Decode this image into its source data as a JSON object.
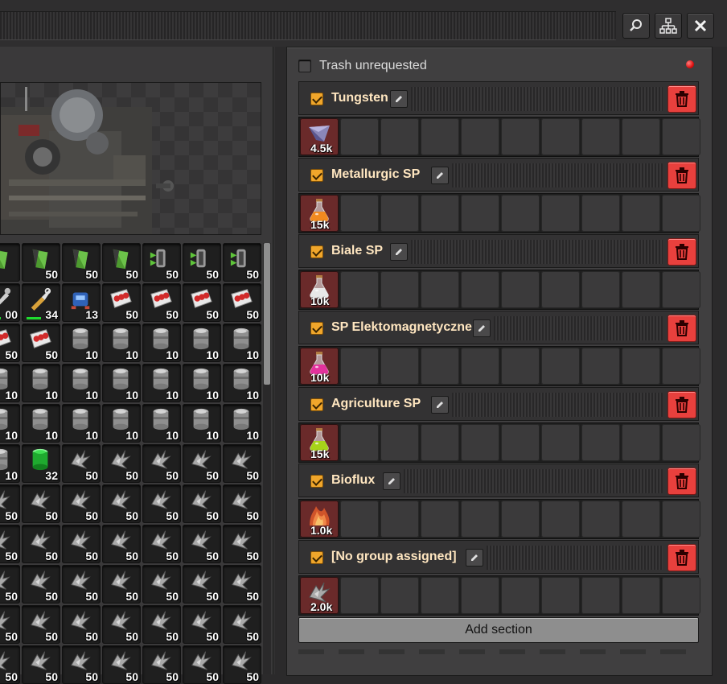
{
  "window": {
    "buttons": [
      {
        "name": "search-button",
        "icon": "search-icon"
      },
      {
        "name": "tree-button",
        "icon": "network-tree-icon"
      },
      {
        "name": "close-button",
        "icon": "close-icon"
      }
    ]
  },
  "inventory": {
    "rows": [
      [
        {
          "icon": "green-item",
          "qty": ""
        },
        {
          "icon": "green-item",
          "qty": "50"
        },
        {
          "icon": "green-item",
          "qty": "50"
        },
        {
          "icon": "green-item",
          "qty": "50"
        },
        {
          "icon": "chain-item",
          "qty": "50"
        },
        {
          "icon": "chain-item",
          "qty": "50"
        },
        {
          "icon": "chain-item",
          "qty": "50"
        }
      ],
      [
        {
          "icon": "tool",
          "qty": "00"
        },
        {
          "icon": "wrench",
          "qty": "34"
        },
        {
          "icon": "blue-robot",
          "qty": "13"
        },
        {
          "icon": "red-card",
          "qty": "50"
        },
        {
          "icon": "red-card",
          "qty": "50"
        },
        {
          "icon": "red-card",
          "qty": "50"
        },
        {
          "icon": "red-card",
          "qty": "50"
        }
      ],
      [
        {
          "icon": "red-card",
          "qty": "50"
        },
        {
          "icon": "red-card",
          "qty": "50"
        },
        {
          "icon": "barrel",
          "qty": "10"
        },
        {
          "icon": "barrel",
          "qty": "10"
        },
        {
          "icon": "barrel",
          "qty": "10"
        },
        {
          "icon": "barrel",
          "qty": "10"
        },
        {
          "icon": "barrel",
          "qty": "10"
        }
      ],
      [
        {
          "icon": "barrel",
          "qty": "10"
        },
        {
          "icon": "barrel",
          "qty": "10"
        },
        {
          "icon": "barrel",
          "qty": "10"
        },
        {
          "icon": "barrel",
          "qty": "10"
        },
        {
          "icon": "barrel",
          "qty": "10"
        },
        {
          "icon": "barrel",
          "qty": "10"
        },
        {
          "icon": "barrel",
          "qty": "10"
        }
      ],
      [
        {
          "icon": "barrel",
          "qty": "10"
        },
        {
          "icon": "barrel",
          "qty": "10"
        },
        {
          "icon": "barrel",
          "qty": "10"
        },
        {
          "icon": "barrel",
          "qty": "10"
        },
        {
          "icon": "barrel",
          "qty": "10"
        },
        {
          "icon": "barrel",
          "qty": "10"
        },
        {
          "icon": "barrel",
          "qty": "10"
        }
      ],
      [
        {
          "icon": "barrel",
          "qty": "10"
        },
        {
          "icon": "green-barrel",
          "qty": "32"
        },
        {
          "icon": "scrap",
          "qty": "50"
        },
        {
          "icon": "scrap",
          "qty": "50"
        },
        {
          "icon": "scrap",
          "qty": "50"
        },
        {
          "icon": "scrap",
          "qty": "50"
        },
        {
          "icon": "scrap",
          "qty": "50"
        }
      ],
      [
        {
          "icon": "scrap",
          "qty": "50"
        },
        {
          "icon": "scrap",
          "qty": "50"
        },
        {
          "icon": "scrap",
          "qty": "50"
        },
        {
          "icon": "scrap",
          "qty": "50"
        },
        {
          "icon": "scrap",
          "qty": "50"
        },
        {
          "icon": "scrap",
          "qty": "50"
        },
        {
          "icon": "scrap",
          "qty": "50"
        }
      ],
      [
        {
          "icon": "scrap",
          "qty": "50"
        },
        {
          "icon": "scrap",
          "qty": "50"
        },
        {
          "icon": "scrap",
          "qty": "50"
        },
        {
          "icon": "scrap",
          "qty": "50"
        },
        {
          "icon": "scrap",
          "qty": "50"
        },
        {
          "icon": "scrap",
          "qty": "50"
        },
        {
          "icon": "scrap",
          "qty": "50"
        }
      ],
      [
        {
          "icon": "scrap",
          "qty": "50"
        },
        {
          "icon": "scrap",
          "qty": "50"
        },
        {
          "icon": "scrap",
          "qty": "50"
        },
        {
          "icon": "scrap",
          "qty": "50"
        },
        {
          "icon": "scrap",
          "qty": "50"
        },
        {
          "icon": "scrap",
          "qty": "50"
        },
        {
          "icon": "scrap",
          "qty": "50"
        }
      ],
      [
        {
          "icon": "scrap",
          "qty": "50"
        },
        {
          "icon": "scrap",
          "qty": "50"
        },
        {
          "icon": "scrap",
          "qty": "50"
        },
        {
          "icon": "scrap",
          "qty": "50"
        },
        {
          "icon": "scrap",
          "qty": "50"
        },
        {
          "icon": "scrap",
          "qty": "50"
        },
        {
          "icon": "scrap",
          "qty": "50"
        }
      ],
      [
        {
          "icon": "scrap",
          "qty": "50"
        },
        {
          "icon": "scrap",
          "qty": "50"
        },
        {
          "icon": "scrap",
          "qty": "50"
        },
        {
          "icon": "scrap",
          "qty": "50"
        },
        {
          "icon": "scrap",
          "qty": "50"
        },
        {
          "icon": "scrap",
          "qty": "50"
        },
        {
          "icon": "scrap",
          "qty": "50"
        }
      ]
    ]
  },
  "logistics": {
    "trash_label": "Trash unrequested",
    "trash_checked": false,
    "add_section_label": "Add section",
    "sections": [
      {
        "title": "Tungsten",
        "checked": true,
        "item": {
          "icon": "tungsten-ore",
          "qty": "4.5k"
        }
      },
      {
        "title": "Metallurgic SP",
        "checked": true,
        "item": {
          "icon": "orange-flask",
          "qty": "15k",
          "color": "#f28a1f"
        }
      },
      {
        "title": "Biale SP",
        "checked": true,
        "item": {
          "icon": "white-flask",
          "qty": "10k",
          "color": "#e8e8e8"
        }
      },
      {
        "title": "SP Elektomagnetyczne",
        "checked": true,
        "item": {
          "icon": "pink-flask",
          "qty": "10k",
          "color": "#e3329c"
        }
      },
      {
        "title": "Agriculture SP",
        "checked": true,
        "item": {
          "icon": "lime-flask",
          "qty": "15k",
          "color": "#a7d419"
        }
      },
      {
        "title": "Bioflux",
        "checked": true,
        "item": {
          "icon": "bioflux",
          "qty": "1.0k"
        }
      },
      {
        "title": "[No group assigned]",
        "checked": true,
        "item": {
          "icon": "scrap",
          "qty": "2.0k"
        }
      }
    ]
  }
}
